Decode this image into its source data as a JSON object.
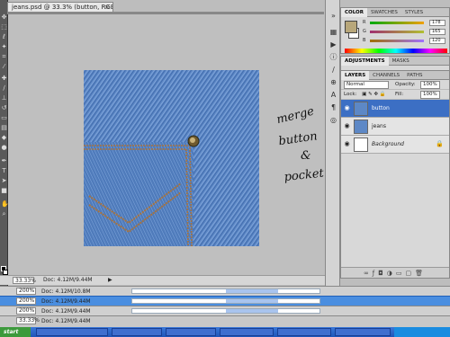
{
  "document": {
    "tab_title": "jeans.psd @ 33.3% (button, RGB/8) *",
    "close_glyph": "×"
  },
  "tools": [
    "move-icon",
    "marquee-icon",
    "lasso-icon",
    "magic-wand-icon",
    "crop-icon",
    "eyedropper-icon",
    "healing-icon",
    "brush-icon",
    "clone-icon",
    "history-brush-icon",
    "eraser-icon",
    "gradient-icon",
    "blur-icon",
    "dodge-icon",
    "pen-icon",
    "type-icon",
    "path-select-icon",
    "shape-icon",
    "hand-icon",
    "zoom-icon"
  ],
  "status": {
    "zoom": "33.33%",
    "doc": "Doc: 4.12M/9.44M"
  },
  "color_panel": {
    "tabs": [
      "COLOR",
      "SWATCHES",
      "STYLES"
    ],
    "rows": [
      {
        "label": "R",
        "value": "178",
        "color": "#d23b3b"
      },
      {
        "label": "G",
        "value": "165",
        "color": "#3bb13b"
      },
      {
        "label": "B",
        "value": "120",
        "color": "#3b5bd2"
      }
    ],
    "foreground": "#b8a77a"
  },
  "adjustments_panel": {
    "tabs": [
      "ADJUSTMENTS",
      "MASKS"
    ]
  },
  "layers_panel": {
    "tabs": [
      "LAYERS",
      "CHANNELS",
      "PATHS"
    ],
    "blend_mode": "Normal",
    "opacity_label": "Opacity:",
    "opacity": "100%",
    "lock_label": "Lock:",
    "fill_label": "Fill:",
    "fill": "100%",
    "layers": [
      {
        "name": "button",
        "selected": true
      },
      {
        "name": "jeans",
        "selected": false
      },
      {
        "name": "Background",
        "selected": false
      }
    ]
  },
  "annotation": {
    "lines": [
      "merge",
      "button",
      "&",
      "pocket"
    ]
  },
  "windows": [
    {
      "zoom": "200%",
      "doc": "Doc: 4.12M/10.8M"
    },
    {
      "zoom": "200%",
      "doc": "Doc: 4.12M/9.44M"
    },
    {
      "zoom": "200%",
      "doc": "Doc: 4.12M/9.44M"
    },
    {
      "zoom": "33.33%",
      "doc": "Doc: 4.12M/9.44M"
    }
  ],
  "taskbar": {
    "start": "start"
  },
  "colors": {
    "denim": "#5b86c4",
    "stitch": "#b07a40",
    "selection": "#3c6fc4"
  }
}
